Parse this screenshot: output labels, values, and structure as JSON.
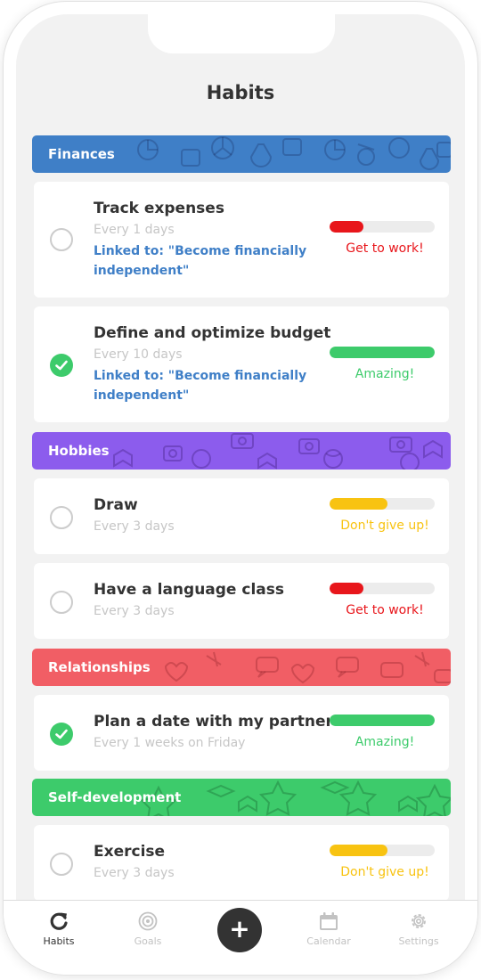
{
  "header": {
    "title": "Habits"
  },
  "sections": [
    {
      "name": "Finances",
      "color": "#3f7fc7",
      "habits": [
        {
          "title": "Track expenses",
          "frequency": "Every 1 days",
          "linked_line1": "Linked to: \"Become financially",
          "linked_line2": "independent\"",
          "completed": false,
          "progress": 0.32,
          "status": "Get to work!",
          "status_color": "#e8161b"
        },
        {
          "title": "Define and optimize budget",
          "frequency": "Every 10 days",
          "linked_line1": "Linked to: \"Become financially",
          "linked_line2": "independent\"",
          "completed": true,
          "progress": 1.0,
          "status": "Amazing!",
          "status_color": "#3dcb6b"
        }
      ]
    },
    {
      "name": "Hobbies",
      "color": "#8c5ced",
      "habits": [
        {
          "title": "Draw",
          "frequency": "Every 3 days",
          "completed": false,
          "progress": 0.55,
          "status": "Don't give up!",
          "status_color": "#f8c311"
        },
        {
          "title": "Have a language class",
          "frequency": "Every 3 days",
          "completed": false,
          "progress": 0.32,
          "status": "Get to work!",
          "status_color": "#e8161b"
        }
      ]
    },
    {
      "name": "Relationships",
      "color": "#f15e65",
      "habits": [
        {
          "title": "Plan a date with my partner",
          "frequency": "Every 1 weeks on Friday",
          "completed": true,
          "progress": 1.0,
          "status": "Amazing!",
          "status_color": "#3dcb6b"
        }
      ]
    },
    {
      "name": "Self-development",
      "color": "#3dcb6b",
      "habits": [
        {
          "title": "Exercise",
          "frequency": "Every 3 days",
          "completed": false,
          "progress": 0.55,
          "status": "Don't give up!",
          "status_color": "#f8c311"
        }
      ]
    }
  ],
  "tabbar": {
    "items": [
      {
        "label": "Habits",
        "icon": "refresh-icon",
        "active": true
      },
      {
        "label": "Goals",
        "icon": "target-icon",
        "active": false
      },
      {
        "label": "+",
        "icon": "plus-icon",
        "active": false
      },
      {
        "label": "Calendar",
        "icon": "calendar-icon",
        "active": false
      },
      {
        "label": "Settings",
        "icon": "gear-icon",
        "active": false
      }
    ]
  }
}
